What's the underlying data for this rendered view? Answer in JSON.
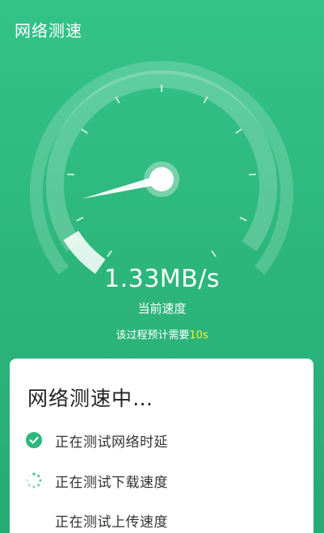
{
  "header": {
    "title": "网络测速"
  },
  "gauge": {
    "current_speed": "1.33MB/s",
    "speed_label": "当前速度",
    "eta_prefix": "该过程预计需要",
    "eta_time": "10s",
    "needle_fraction": 0.08
  },
  "card": {
    "title": "网络测速中…",
    "steps": [
      {
        "label": "正在测试网络时延",
        "status": "done",
        "icon": "check-circle-icon"
      },
      {
        "label": "正在测试下载速度",
        "status": "in-progress",
        "icon": "loading-spinner-icon"
      },
      {
        "label": "正在测试上传速度",
        "status": "pending",
        "icon": ""
      }
    ]
  },
  "colors": {
    "background": "#2db77d",
    "accent": "#2db77d",
    "eta_highlight": "#f4f03a",
    "card": "#ffffff"
  }
}
